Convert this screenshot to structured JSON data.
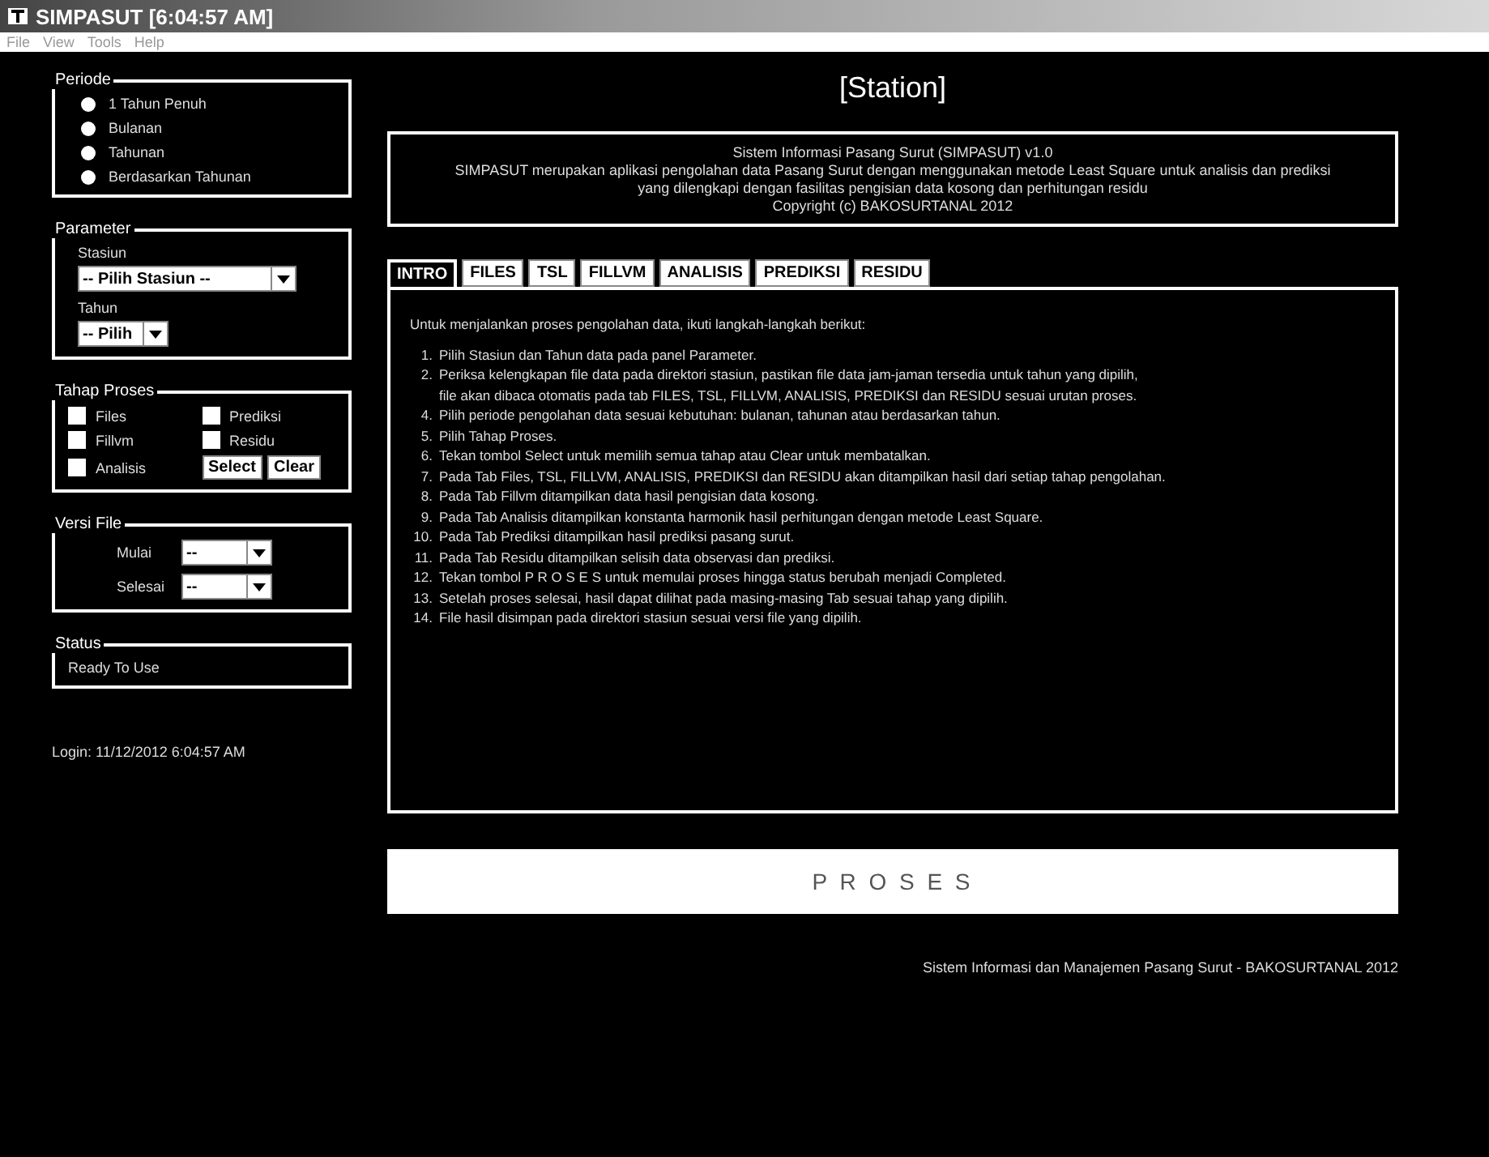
{
  "window": {
    "title": "SIMPASUT [6:04:57 AM]"
  },
  "menu": [
    "File",
    "View",
    "Tools",
    "Help"
  ],
  "periode": {
    "title": "Periode",
    "options": [
      {
        "label": "1 Tahun Penuh",
        "selected": false
      },
      {
        "label": "Bulanan",
        "selected": false
      },
      {
        "label": "Tahunan",
        "selected": false
      },
      {
        "label": "Berdasarkan Tahunan",
        "selected": false
      }
    ]
  },
  "parameter": {
    "title": "Parameter",
    "fields": [
      {
        "label": "Stasiun",
        "value": "-- Pilih Stasiun --"
      },
      {
        "label": "Tahun",
        "value": "-- Pilih"
      }
    ]
  },
  "tahap": {
    "title": "Tahap Proses",
    "items": [
      {
        "label": "Files",
        "checked": false
      },
      {
        "label": "Prediksi",
        "checked": false
      },
      {
        "label": "Fillvm",
        "checked": false
      },
      {
        "label": "Residu",
        "checked": false
      },
      {
        "label": "Analisis",
        "checked": false
      }
    ],
    "buttons": [
      "Select",
      "Clear"
    ]
  },
  "versi": {
    "title": "Versi File",
    "fields": [
      {
        "label": "Mulai",
        "value": "--"
      },
      {
        "label": "Selesai",
        "value": "--"
      }
    ]
  },
  "status": {
    "title": "Status",
    "text": "Ready To Use"
  },
  "heading": "[Station]",
  "info": [
    "Sistem Informasi Pasang Surut (SIMPASUT) v1.0",
    "SIMPASUT merupakan aplikasi pengolahan data Pasang Surut dengan menggunakan metode Least Square untuk analisis dan prediksi",
    "yang dilengkapi dengan fasilitas pengisian data kosong dan perhitungan residu",
    "Copyright (c) BAKOSURTANAL 2012"
  ],
  "tabs": [
    {
      "label": "INTRO",
      "selected": true
    },
    {
      "label": "FILES",
      "selected": false
    },
    {
      "label": "TSL",
      "selected": false
    },
    {
      "label": "FILLVM",
      "selected": false
    },
    {
      "label": "ANALISIS",
      "selected": false
    },
    {
      "label": "PREDIKSI",
      "selected": false
    },
    {
      "label": "RESIDU",
      "selected": false
    }
  ],
  "intro": {
    "heading": "Untuk menjalankan proses pengolahan data, ikuti langkah-langkah berikut:",
    "steps": [
      {
        "num": "1.",
        "text": "Pilih Stasiun dan Tahun data pada panel Parameter."
      },
      {
        "num": "2.",
        "text": "Periksa kelengkapan file data pada direktori stasiun, pastikan file data jam-jaman tersedia untuk tahun yang dipilih,"
      },
      {
        "text": "file akan dibaca otomatis pada tab FILES, TSL, FILLVM, ANALISIS, PREDIKSI dan RESIDU sesuai urutan proses."
      },
      {
        "num": "4.",
        "text": "Pilih periode pengolahan data sesuai kebutuhan: bulanan, tahunan atau berdasarkan tahun."
      },
      {
        "num": "5.",
        "text": "Pilih Tahap Proses."
      },
      {
        "num": "6.",
        "text": "Tekan tombol Select untuk memilih semua tahap atau Clear untuk membatalkan."
      },
      {
        "num": "7.",
        "text": "Pada Tab Files, TSL, FILLVM, ANALISIS, PREDIKSI dan RESIDU akan ditampilkan hasil dari setiap tahap pengolahan."
      },
      {
        "num": "8.",
        "text": "Pada Tab Fillvm ditampilkan data hasil pengisian data kosong."
      },
      {
        "num": "9.",
        "text": "Pada Tab Analisis ditampilkan konstanta harmonik hasil perhitungan dengan metode Least Square."
      },
      {
        "num": "10.",
        "text": "Pada Tab Prediksi ditampilkan hasil prediksi pasang surut."
      },
      {
        "num": "11.",
        "text": "Pada Tab Residu ditampilkan selisih data observasi dan prediksi."
      },
      {
        "num": "12.",
        "text": "Tekan tombol P R O S E S untuk memulai proses hingga status berubah menjadi Completed."
      },
      {
        "num": "13.",
        "text": "Setelah proses selesai, hasil dapat dilihat pada masing-masing Tab sesuai tahap yang dipilih."
      },
      {
        "num": "14.",
        "text": "File hasil disimpan pada direktori stasiun sesuai versi file yang dipilih."
      }
    ]
  },
  "process_button": "P R O S E S",
  "footer": {
    "left": "Login: 11/12/2012 6:04:57 AM",
    "right": "Sistem Informasi dan Manajemen Pasang Surut - BAKOSURTANAL 2012"
  }
}
